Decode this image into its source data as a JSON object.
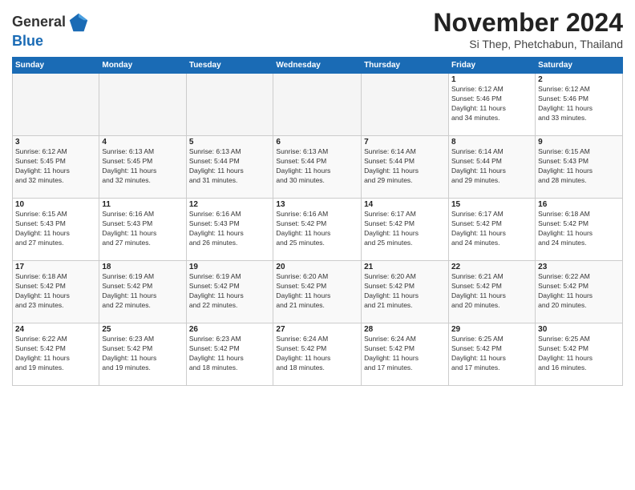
{
  "header": {
    "logo_general": "General",
    "logo_blue": "Blue",
    "month_title": "November 2024",
    "subtitle": "Si Thep, Phetchabun, Thailand"
  },
  "weekdays": [
    "Sunday",
    "Monday",
    "Tuesday",
    "Wednesday",
    "Thursday",
    "Friday",
    "Saturday"
  ],
  "weeks": [
    [
      {
        "day": "",
        "info": "",
        "empty": true
      },
      {
        "day": "",
        "info": "",
        "empty": true
      },
      {
        "day": "",
        "info": "",
        "empty": true
      },
      {
        "day": "",
        "info": "",
        "empty": true
      },
      {
        "day": "",
        "info": "",
        "empty": true
      },
      {
        "day": "1",
        "info": "Sunrise: 6:12 AM\nSunset: 5:46 PM\nDaylight: 11 hours\nand 34 minutes."
      },
      {
        "day": "2",
        "info": "Sunrise: 6:12 AM\nSunset: 5:46 PM\nDaylight: 11 hours\nand 33 minutes."
      }
    ],
    [
      {
        "day": "3",
        "info": "Sunrise: 6:12 AM\nSunset: 5:45 PM\nDaylight: 11 hours\nand 32 minutes."
      },
      {
        "day": "4",
        "info": "Sunrise: 6:13 AM\nSunset: 5:45 PM\nDaylight: 11 hours\nand 32 minutes."
      },
      {
        "day": "5",
        "info": "Sunrise: 6:13 AM\nSunset: 5:44 PM\nDaylight: 11 hours\nand 31 minutes."
      },
      {
        "day": "6",
        "info": "Sunrise: 6:13 AM\nSunset: 5:44 PM\nDaylight: 11 hours\nand 30 minutes."
      },
      {
        "day": "7",
        "info": "Sunrise: 6:14 AM\nSunset: 5:44 PM\nDaylight: 11 hours\nand 29 minutes."
      },
      {
        "day": "8",
        "info": "Sunrise: 6:14 AM\nSunset: 5:44 PM\nDaylight: 11 hours\nand 29 minutes."
      },
      {
        "day": "9",
        "info": "Sunrise: 6:15 AM\nSunset: 5:43 PM\nDaylight: 11 hours\nand 28 minutes."
      }
    ],
    [
      {
        "day": "10",
        "info": "Sunrise: 6:15 AM\nSunset: 5:43 PM\nDaylight: 11 hours\nand 27 minutes."
      },
      {
        "day": "11",
        "info": "Sunrise: 6:16 AM\nSunset: 5:43 PM\nDaylight: 11 hours\nand 27 minutes."
      },
      {
        "day": "12",
        "info": "Sunrise: 6:16 AM\nSunset: 5:43 PM\nDaylight: 11 hours\nand 26 minutes."
      },
      {
        "day": "13",
        "info": "Sunrise: 6:16 AM\nSunset: 5:42 PM\nDaylight: 11 hours\nand 25 minutes."
      },
      {
        "day": "14",
        "info": "Sunrise: 6:17 AM\nSunset: 5:42 PM\nDaylight: 11 hours\nand 25 minutes."
      },
      {
        "day": "15",
        "info": "Sunrise: 6:17 AM\nSunset: 5:42 PM\nDaylight: 11 hours\nand 24 minutes."
      },
      {
        "day": "16",
        "info": "Sunrise: 6:18 AM\nSunset: 5:42 PM\nDaylight: 11 hours\nand 24 minutes."
      }
    ],
    [
      {
        "day": "17",
        "info": "Sunrise: 6:18 AM\nSunset: 5:42 PM\nDaylight: 11 hours\nand 23 minutes."
      },
      {
        "day": "18",
        "info": "Sunrise: 6:19 AM\nSunset: 5:42 PM\nDaylight: 11 hours\nand 22 minutes."
      },
      {
        "day": "19",
        "info": "Sunrise: 6:19 AM\nSunset: 5:42 PM\nDaylight: 11 hours\nand 22 minutes."
      },
      {
        "day": "20",
        "info": "Sunrise: 6:20 AM\nSunset: 5:42 PM\nDaylight: 11 hours\nand 21 minutes."
      },
      {
        "day": "21",
        "info": "Sunrise: 6:20 AM\nSunset: 5:42 PM\nDaylight: 11 hours\nand 21 minutes."
      },
      {
        "day": "22",
        "info": "Sunrise: 6:21 AM\nSunset: 5:42 PM\nDaylight: 11 hours\nand 20 minutes."
      },
      {
        "day": "23",
        "info": "Sunrise: 6:22 AM\nSunset: 5:42 PM\nDaylight: 11 hours\nand 20 minutes."
      }
    ],
    [
      {
        "day": "24",
        "info": "Sunrise: 6:22 AM\nSunset: 5:42 PM\nDaylight: 11 hours\nand 19 minutes."
      },
      {
        "day": "25",
        "info": "Sunrise: 6:23 AM\nSunset: 5:42 PM\nDaylight: 11 hours\nand 19 minutes."
      },
      {
        "day": "26",
        "info": "Sunrise: 6:23 AM\nSunset: 5:42 PM\nDaylight: 11 hours\nand 18 minutes."
      },
      {
        "day": "27",
        "info": "Sunrise: 6:24 AM\nSunset: 5:42 PM\nDaylight: 11 hours\nand 18 minutes."
      },
      {
        "day": "28",
        "info": "Sunrise: 6:24 AM\nSunset: 5:42 PM\nDaylight: 11 hours\nand 17 minutes."
      },
      {
        "day": "29",
        "info": "Sunrise: 6:25 AM\nSunset: 5:42 PM\nDaylight: 11 hours\nand 17 minutes."
      },
      {
        "day": "30",
        "info": "Sunrise: 6:25 AM\nSunset: 5:42 PM\nDaylight: 11 hours\nand 16 minutes."
      }
    ]
  ]
}
